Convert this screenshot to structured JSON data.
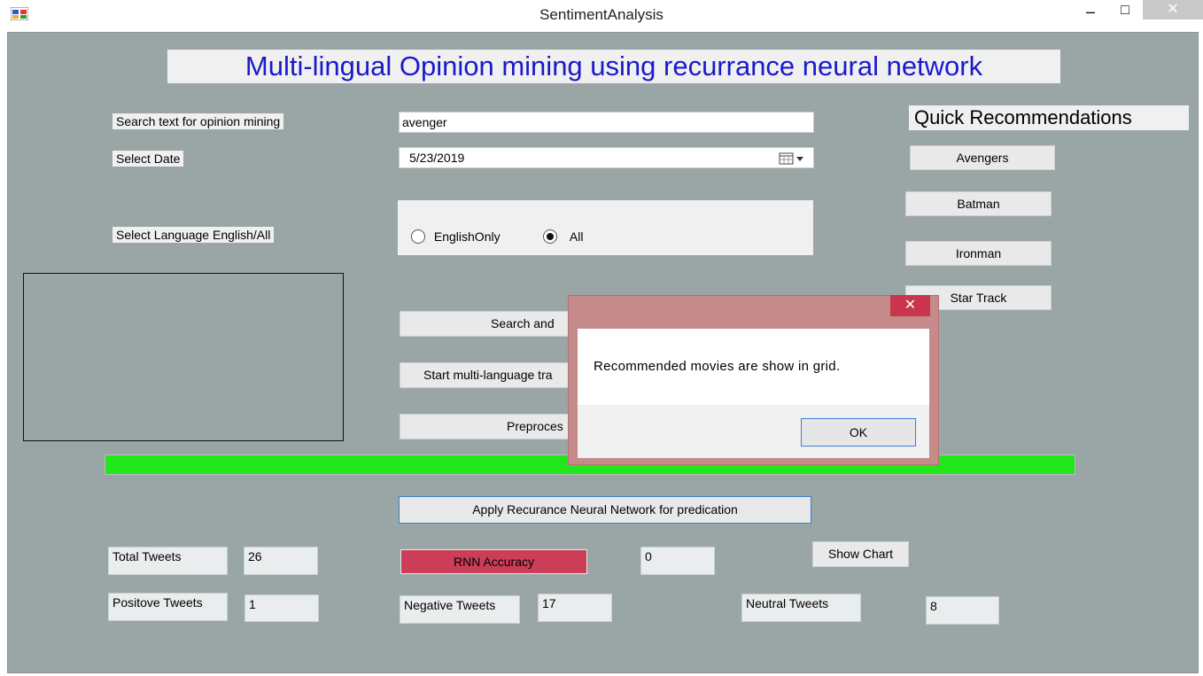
{
  "window": {
    "title": "SentimentAnalysis",
    "minimize": "–",
    "maximize": "□",
    "close": "✕"
  },
  "heading": "Multi-lingual Opinion mining using recurrance neural network",
  "form": {
    "search_label": "Search text for opinion mining",
    "search_value": "avenger",
    "date_label": "Select Date",
    "date_value": "5/23/2019",
    "language_label": "Select Language English/All",
    "radio_english": "EnglishOnly",
    "radio_all": "All",
    "selected_language": "All"
  },
  "buttons": {
    "search": "Search and",
    "start_translation": "Start multi-language tra",
    "preprocess": "Preproces",
    "apply_rnn": "Apply Recurance Neural Network for predication",
    "show_chart": "Show Chart"
  },
  "progress": {
    "value": 1.0,
    "color": "#22e61c"
  },
  "quick": {
    "title": "Quick Recommendations",
    "items": [
      "Avengers",
      "Batman",
      "Ironman",
      "Star Track"
    ]
  },
  "stats": {
    "total_label": "Total Tweets",
    "total_value": "26",
    "positive_label": "Positove Tweets",
    "positive_value": "1",
    "accuracy_label": "RNN Accuracy",
    "accuracy_value": "0",
    "negative_label": "Negative Tweets",
    "negative_value": "17",
    "neutral_label": "Neutral Tweets",
    "neutral_value": "8"
  },
  "dialog": {
    "message": "Recommended movies are show in grid.",
    "ok": "OK",
    "close": "✕"
  },
  "colors": {
    "accent_heading": "#1a1acc",
    "accuracy_bg": "#cc3d57",
    "background": "#9aa6a6"
  }
}
